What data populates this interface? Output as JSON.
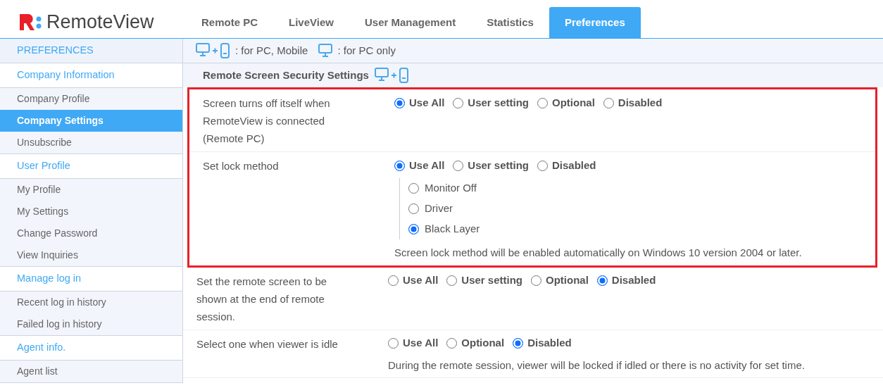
{
  "brand": {
    "name": "RemoteView"
  },
  "tabs": [
    {
      "label": "Remote PC",
      "selected": false
    },
    {
      "label": "LiveView",
      "selected": false
    },
    {
      "label": "User Management",
      "selected": false
    },
    {
      "label": "Statistics",
      "selected": false
    },
    {
      "label": "Preferences",
      "selected": true
    }
  ],
  "sidebar": {
    "title": "PREFERENCES",
    "groups": [
      {
        "label": "Company Information",
        "items": [
          {
            "label": "Company Profile",
            "selected": false
          },
          {
            "label": "Company Settings",
            "selected": true
          },
          {
            "label": "Unsubscribe",
            "selected": false
          }
        ]
      },
      {
        "label": "User Profile",
        "items": [
          {
            "label": "My Profile",
            "selected": false
          },
          {
            "label": "My Settings",
            "selected": false
          },
          {
            "label": "Change Password",
            "selected": false
          },
          {
            "label": "View Inquiries",
            "selected": false
          }
        ]
      },
      {
        "label": "Manage log in",
        "items": [
          {
            "label": "Recent log in history",
            "selected": false
          },
          {
            "label": "Failed log in history",
            "selected": false
          }
        ]
      },
      {
        "label": "Agent info.",
        "items": [
          {
            "label": "Agent list",
            "selected": false
          }
        ]
      }
    ]
  },
  "legend": [
    {
      "kind": "pc-mobile",
      "text": ": for PC, Mobile"
    },
    {
      "kind": "pc",
      "text": ": for PC only"
    }
  ],
  "section": {
    "title": "Remote Screen Security Settings",
    "kind": "pc-mobile"
  },
  "settings": [
    {
      "label": "Screen turns off itself when RemoteView is connected (Remote PC)",
      "highlighted": true,
      "options": [
        {
          "label": "Use All",
          "selected": true
        },
        {
          "label": "User setting",
          "selected": false
        },
        {
          "label": "Optional",
          "selected": false
        },
        {
          "label": "Disabled",
          "selected": false
        }
      ]
    },
    {
      "label": "Set lock method",
      "highlighted": true,
      "options": [
        {
          "label": "Use All",
          "selected": true
        },
        {
          "label": "User setting",
          "selected": false
        },
        {
          "label": "Disabled",
          "selected": false
        }
      ],
      "sub_options": [
        {
          "label": "Monitor Off",
          "selected": false
        },
        {
          "label": "Driver",
          "selected": false
        },
        {
          "label": "Black Layer",
          "selected": true
        }
      ],
      "note": "Screen lock method will be enabled automatically on Windows 10 version 2004 or later."
    },
    {
      "label": "Set the remote screen to be shown at the end of remote session.",
      "highlighted": false,
      "options": [
        {
          "label": "Use All",
          "selected": false
        },
        {
          "label": "User setting",
          "selected": false
        },
        {
          "label": "Optional",
          "selected": false
        },
        {
          "label": "Disabled",
          "selected": true
        }
      ]
    },
    {
      "label": "Select one when viewer is idle",
      "highlighted": false,
      "options": [
        {
          "label": "Use All",
          "selected": false
        },
        {
          "label": "Optional",
          "selected": false
        },
        {
          "label": "Disabled",
          "selected": true
        }
      ],
      "note": "During the remote session, viewer will be locked if idled or there is no activity for set time."
    }
  ]
}
